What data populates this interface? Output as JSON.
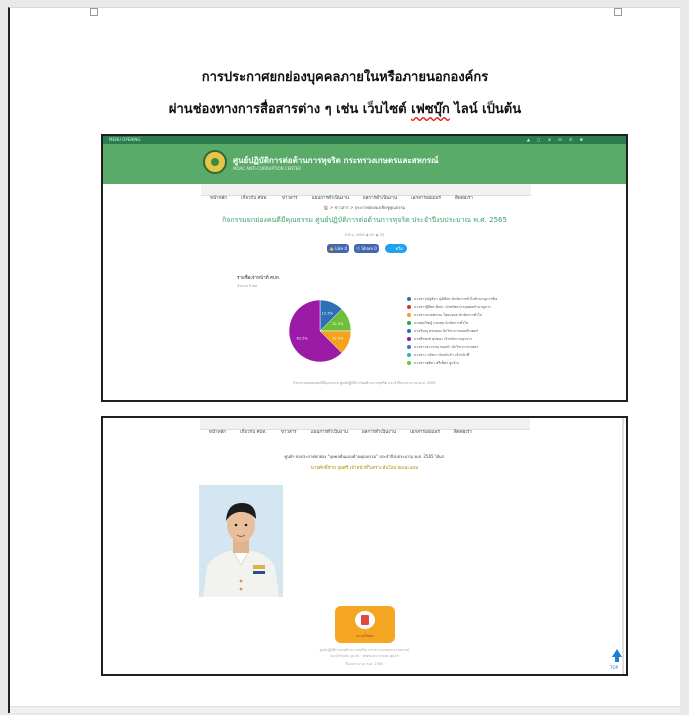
{
  "doc": {
    "heading_1": "การประกาศยกย่องบุคคลภายในหรือภายนอกองค์กร",
    "heading_2_prefix": "ผ่านช่องทางการสื่อสารต่าง ๆ เช่น เว็บไซต์ ",
    "heading_2_word": "เฟซบุ๊ก",
    "heading_2_suffix": " ไลน์ เป็นต้น"
  },
  "shot1": {
    "top_left": "MENU   OPENING",
    "top_right": "▲  ◻  ⊕  ✉  ✆  ✱",
    "site_title": "ศูนย์ปฏิบัติการต่อต้านการทุจริต กระทรวงเกษตรและสหกรณ์",
    "site_subtitle": "MOAC ANTI-CORRUPTION CENTER",
    "nav": [
      "หน้าหลัก",
      "เกี่ยวกับ ศปท.",
      "ข่าวสาร",
      "แผนการดำเนินงาน",
      "ผลการดำเนินงาน",
      "เอกสารเผยแพร่",
      "ติดต่อเรา"
    ],
    "breadcrumb": "🏠  >  ข่าวสาร  >  ประกาศยกย่องเชิดชูคุณธรรม",
    "post_title": "กิจกรรมยกย่องคนดีมีคุณธรรม ศูนย์ปฏิบัติการต่อต้านการทุจริต ประจำปีงบประมาณ พ.ศ. 2565",
    "post_meta": "9 มิ.ย. 2565   ◉ 90   ◉ 35",
    "share_like": "👍 Like 0",
    "share_fb": "ⓕ Share 0",
    "share_tw": "🐦 ทวีต",
    "chart_title": "รายชื่อเจ้าหน้าที่ ศปท.",
    "chart_subtitle": "จำนวน 5 คน",
    "caption": "กิจกรรมยกย่องคนดีมีคุณธรรม ศูนย์ปฏิบัติการต่อต้านการทุจริต ประจำปีงบประมาณ พ.ศ. 2565"
  },
  "chart_data": {
    "type": "pie",
    "title": "รายชื่อเจ้าหน้าที่ ศปท.",
    "slices": [
      {
        "value": 12.5,
        "label": "12.5%",
        "color": "#2f6fb5"
      },
      {
        "value": 12.5,
        "label": "12.5%",
        "color": "#6fbf3a"
      },
      {
        "value": 12.5,
        "label": "12.5%",
        "color": "#f4a21d"
      },
      {
        "value": 62.5,
        "label": "62.5%",
        "color": "#9b1aa6"
      }
    ],
    "legend": [
      {
        "label": "นางสาวณัฐธิดา ปุณิธิศร นักจัดการทั่วไปชำนาญการพิเศษ",
        "color": "#2f6fb5"
      },
      {
        "label": "นางสาวฐิติพร ศิลปะ นักทรัพยากรบุคคลชำนาญการ",
        "color": "#d9342b"
      },
      {
        "label": "นางสาวกมลพรรณ ไชยมงคล นักจัดการทั่วไป",
        "color": "#f4a21d"
      },
      {
        "label": "นายศุภวิชญ์ แสงสุข นักจัดการทั่วไป",
        "color": "#2e9d5a"
      },
      {
        "label": "นายวิษณุ พรมทอง นักวิชาการคอมพิวเตอร์",
        "color": "#1f6fd0"
      },
      {
        "label": "นายธีรพงษ์ ขุนทอง เจ้าพนักงานธุรการ",
        "color": "#8a1f9a"
      },
      {
        "label": "นางสาวอรวรรณ ทองคำ นักวิชาการเกษตร",
        "color": "#3a77c8"
      },
      {
        "label": "นางสาว ปภัสรา จันทร์แก้ว เจ้าหน้าที่",
        "color": "#2bb3c0"
      },
      {
        "label": "นางสาวชุติมา ศรีเพ็ชร ลูกจ้าง",
        "color": "#6fbf3a"
      }
    ]
  },
  "shot2": {
    "announcement": "ศูนย์ฯ ขอประกาศยกย่อง \"บุคคลต้นแบบด้านคุณธรรม\" ประจำปีงบประมาณ พ.ศ. 2565 ได้แก่",
    "person": "นายศักดิ์ชาย บุษศรี เจ้าหน้าที่วิเคราะห์นโยบายและแผน",
    "pdf_label": "ดาวน์โหลด",
    "footer_1": "ศูนย์ปฏิบัติการต่อต้านการทุจริต กระทรวงเกษตรและสหกรณ์",
    "footer_2": "acc@moac.go.th  ·  www.acc.moac.go.th",
    "footer_3": "ปีงบประมาณ พ.ศ. 2565",
    "to_top": "TOP"
  }
}
